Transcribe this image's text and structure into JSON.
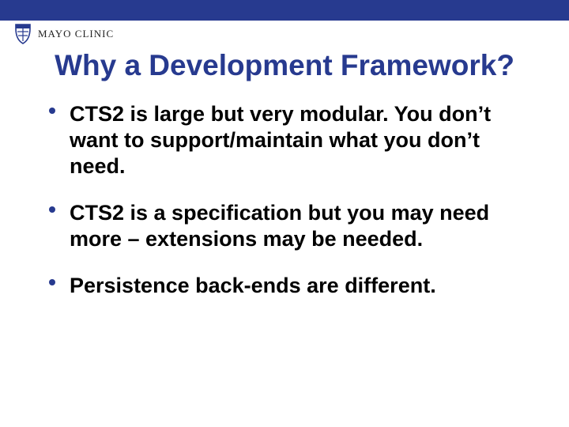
{
  "brand": {
    "name": "MAYO CLINIC",
    "accent": "#273a8f"
  },
  "slide": {
    "title": "Why a Development Framework?",
    "bullets": [
      "CTS2 is large but very modular. You don’t want to support/maintain what you don’t need.",
      "CTS2 is a specification but you may need more – extensions may be needed.",
      "Persistence back-ends are different."
    ]
  }
}
